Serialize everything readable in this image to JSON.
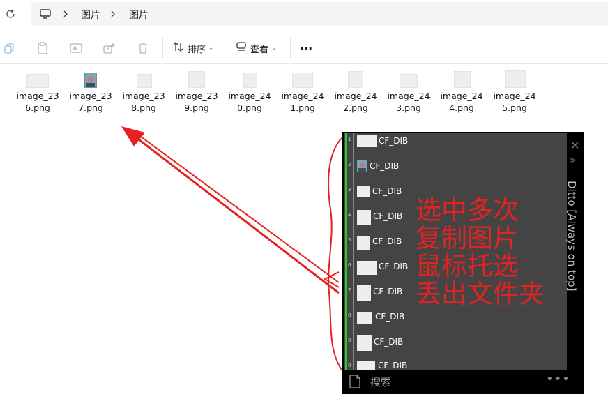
{
  "address_bar": {
    "breadcrumbs": [
      "图片",
      "图片"
    ]
  },
  "toolbar": {
    "sort_label": "排序",
    "view_label": "查看",
    "more_label": "···"
  },
  "files": [
    {
      "line1": "image_23",
      "line2": "6.png"
    },
    {
      "line1": "image_23",
      "line2": "7.png"
    },
    {
      "line1": "image_23",
      "line2": "8.png"
    },
    {
      "line1": "image_23",
      "line2": "9.png"
    },
    {
      "line1": "image_24",
      "line2": "0.png"
    },
    {
      "line1": "image_24",
      "line2": "1.png"
    },
    {
      "line1": "image_24",
      "line2": "2.png"
    },
    {
      "line1": "image_24",
      "line2": "3.png"
    },
    {
      "line1": "image_24",
      "line2": "4.png"
    },
    {
      "line1": "image_24",
      "line2": "5.png"
    }
  ],
  "ditto": {
    "title": "Ditto [Always on top]",
    "rows": [
      {
        "num": "1",
        "label": "CF_DIB"
      },
      {
        "num": "2",
        "label": "CF_DIB"
      },
      {
        "num": "3",
        "label": "CF_DIB"
      },
      {
        "num": "4",
        "label": "CF_DIB"
      },
      {
        "num": "5",
        "label": "CF_DIB"
      },
      {
        "num": "6",
        "label": "CF_DIB"
      },
      {
        "num": "7",
        "label": "CF_DIB"
      },
      {
        "num": "8",
        "label": "CF_DIB"
      },
      {
        "num": "9",
        "label": "CF_DIB"
      },
      {
        "num": "0",
        "label": "CF_DIB"
      }
    ],
    "search_label": "搜索",
    "menu_dots": "•••",
    "close_glyph": "✕",
    "more_glyph": "»"
  },
  "annotation": {
    "lines": [
      "选中多次",
      "复制图片",
      "鼠标托选",
      "丢出文件夹"
    ],
    "color": "#e52222"
  }
}
